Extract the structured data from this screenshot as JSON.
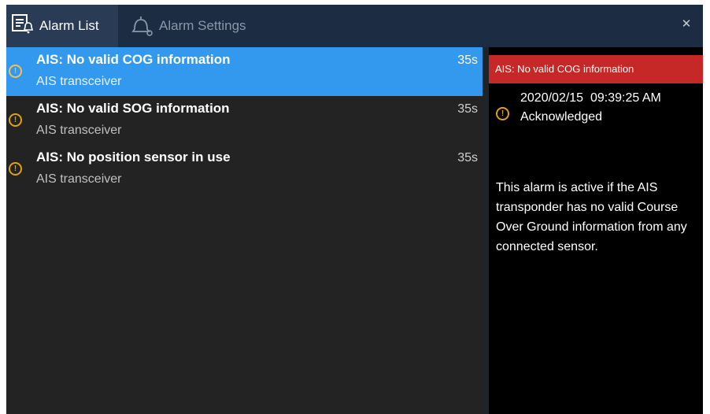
{
  "tabs": {
    "alarm_list": {
      "label": "Alarm List",
      "icon": "alarm-list-icon"
    },
    "alarm_settings": {
      "label": "Alarm Settings",
      "icon": "bell-settings-icon"
    }
  },
  "close_icon": "close-icon",
  "alarms": [
    {
      "title": "AIS: No valid COG information",
      "source": "AIS transceiver",
      "age": "35s",
      "selected": true
    },
    {
      "title": "AIS: No valid SOG information",
      "source": "AIS transceiver",
      "age": "35s",
      "selected": false
    },
    {
      "title": "AIS: No position sensor in use",
      "source": "AIS transceiver",
      "age": "35s",
      "selected": false
    }
  ],
  "detail": {
    "header": "AIS: No valid COG information",
    "timestamp": "2020/02/15  09:39:25 AM",
    "status": "Acknowledged",
    "description": "This alarm is active if the AIS transponder has no valid Course Over Ground information from any connected sensor."
  },
  "colors": {
    "tabbar": "#1b2c43",
    "selected_row": "#3399ee",
    "detail_header": "#c62828",
    "warning": "#e0a018"
  }
}
